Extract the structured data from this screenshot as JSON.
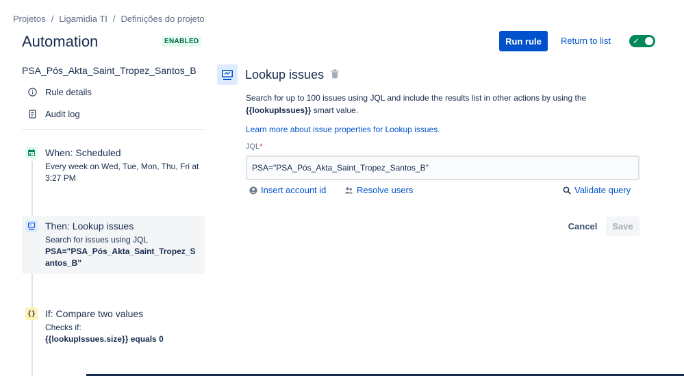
{
  "breadcrumb": {
    "items": [
      "Projetos",
      "Ligamidia TI",
      "Definições do projeto"
    ],
    "separator": "/"
  },
  "header": {
    "title": "Automation",
    "status_badge": "ENABLED",
    "run_rule_label": "Run rule",
    "return_label": "Return to list",
    "toggle_state": "on"
  },
  "sidebar": {
    "rule_name": "PSA_Pós_Akta_Saint_Tropez_Santos_B",
    "links": [
      {
        "label": "Rule details",
        "icon": "info-icon"
      },
      {
        "label": "Audit log",
        "icon": "document-icon"
      }
    ],
    "steps": [
      {
        "title": "When: Scheduled",
        "desc": "Every week on Wed, Tue, Mon, Thu, Fri at 3:27 PM",
        "strong": "",
        "icon": "calendar-icon",
        "icon_color": "#00875a",
        "icon_bg": "#e3fcef"
      },
      {
        "title": "Then: Lookup issues",
        "desc": "Search for issues using JQL",
        "strong": "PSA=\"PSA_Pós_Akta_Saint_Tropez_Santos_B\"",
        "icon": "monitor-icon",
        "icon_color": "#0052cc",
        "icon_bg": "#deebff"
      },
      {
        "title": "If: Compare two values",
        "desc": "Checks if:",
        "strong": "{{lookupIssues.size}} equals 0",
        "icon": "braces-icon",
        "icon_color": "#172b4d",
        "icon_bg": "#fff0b3"
      }
    ]
  },
  "panel": {
    "title": "Lookup issues",
    "description_pre": "Search for up to 100 issues using JQL and include the results list in other actions by using the",
    "description_code": "{{lookupIssues}}",
    "description_post": " smart value.",
    "learn_more": "Learn more about issue properties for Lookup issues.",
    "jql_label": "JQL",
    "jql_required_mark": "*",
    "jql_value": "PSA=\"PSA_Pós_Akta_Saint_Tropez_Santos_B\"",
    "insert_account_label": "Insert account id",
    "resolve_users_label": "Resolve users",
    "validate_query_label": "Validate query",
    "cancel_label": "Cancel",
    "save_label": "Save"
  },
  "colors": {
    "primary": "#0052cc",
    "success": "#00875a",
    "text": "#172b4d"
  }
}
